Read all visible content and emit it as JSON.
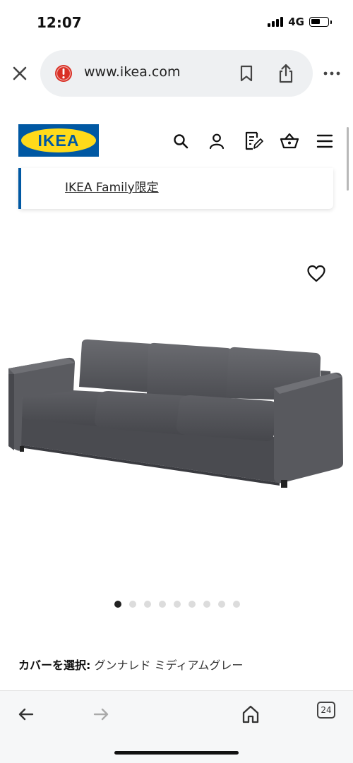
{
  "status_bar": {
    "time": "12:07",
    "network": "4G"
  },
  "browser": {
    "url": "www.ikea.com",
    "tabs_count": "24"
  },
  "ikea": {
    "logo_text": "IKEA",
    "family_link": "IKEA Family限定"
  },
  "product": {
    "cover_label": "カバーを選択:",
    "cover_value": "グンナレド ミディアムグレー",
    "image_count": 9,
    "active_image": 1
  },
  "colors": {
    "ikea_blue": "#0058a3",
    "ikea_yellow": "#ffda1a",
    "warning_red": "#d93025"
  }
}
